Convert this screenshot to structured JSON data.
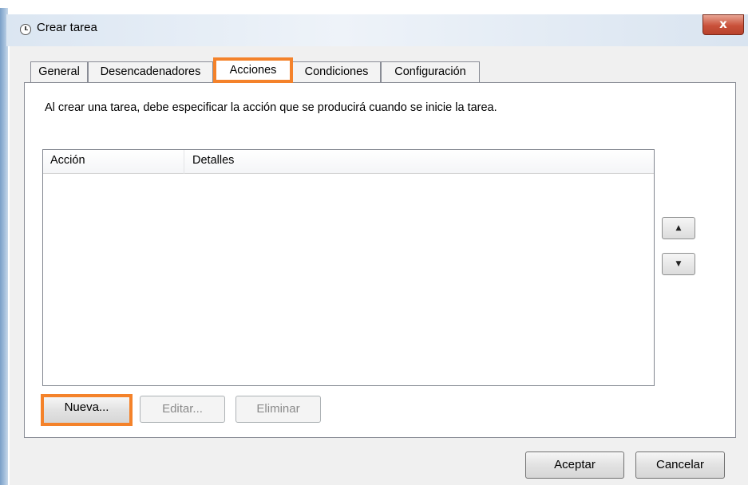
{
  "window": {
    "title": "Crear tarea",
    "close_label": "x"
  },
  "tabs": [
    {
      "label": "General"
    },
    {
      "label": "Desencadenadores"
    },
    {
      "label": "Acciones",
      "active": true
    },
    {
      "label": "Condiciones"
    },
    {
      "label": "Configuración"
    }
  ],
  "actions_tab": {
    "description": "Al crear una tarea, debe especificar la acción que se producirá cuando se inicie la tarea.",
    "table": {
      "columns": [
        "Acción",
        "Detalles"
      ],
      "rows": []
    },
    "move_up_glyph": "▲",
    "move_down_glyph": "▼",
    "new_label": "Nueva...",
    "edit_label": "Editar...",
    "delete_label": "Eliminar"
  },
  "footer": {
    "ok_label": "Aceptar",
    "cancel_label": "Cancelar"
  },
  "colors": {
    "highlight": "#f4822a",
    "close_button": "#c9513a"
  }
}
